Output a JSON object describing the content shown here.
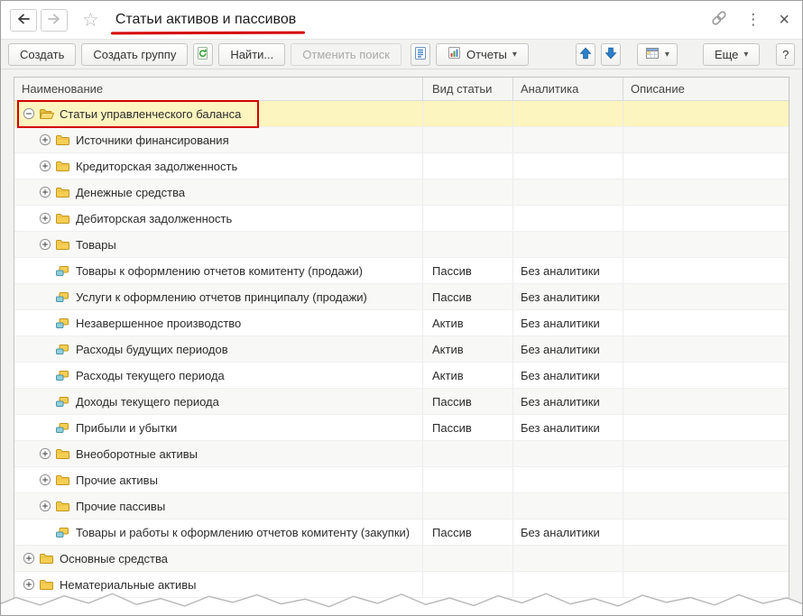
{
  "titlebar": {
    "title": "Статьи активов и пассивов"
  },
  "toolbar": {
    "create_label": "Создать",
    "create_group_label": "Создать группу",
    "find_label": "Найти...",
    "cancel_search_label": "Отменить поиск",
    "reports_label": "Отчеты",
    "more_label": "Еще",
    "help_label": "?"
  },
  "table": {
    "columns": [
      "Наименование",
      "Вид статьи",
      "Аналитика",
      "Описание"
    ],
    "rows": [
      {
        "type": "group",
        "level": 0,
        "expanded": true,
        "selected": true,
        "annotated": true,
        "name": "Статьи управленческого баланса",
        "kind": "",
        "analytics": ""
      },
      {
        "type": "group",
        "level": 1,
        "expanded": false,
        "name": "Источники финансирования",
        "kind": "",
        "analytics": ""
      },
      {
        "type": "group",
        "level": 1,
        "expanded": false,
        "name": "Кредиторская задолженность",
        "kind": "",
        "analytics": ""
      },
      {
        "type": "group",
        "level": 1,
        "expanded": false,
        "name": "Денежные средства",
        "kind": "",
        "analytics": ""
      },
      {
        "type": "group",
        "level": 1,
        "expanded": false,
        "name": "Дебиторская задолженность",
        "kind": "",
        "analytics": ""
      },
      {
        "type": "group",
        "level": 1,
        "expanded": false,
        "name": "Товары",
        "kind": "",
        "analytics": ""
      },
      {
        "type": "item",
        "level": 1,
        "name": "Товары к оформлению отчетов комитенту (продажи)",
        "kind": "Пассив",
        "analytics": "Без аналитики"
      },
      {
        "type": "item",
        "level": 1,
        "name": "Услуги к оформлению отчетов принципалу (продажи)",
        "kind": "Пассив",
        "analytics": "Без аналитики"
      },
      {
        "type": "item",
        "level": 1,
        "name": "Незавершенное производство",
        "kind": "Актив",
        "analytics": "Без аналитики"
      },
      {
        "type": "item",
        "level": 1,
        "name": "Расходы будущих периодов",
        "kind": "Актив",
        "analytics": "Без аналитики"
      },
      {
        "type": "item",
        "level": 1,
        "name": "Расходы текущего периода",
        "kind": "Актив",
        "analytics": "Без аналитики"
      },
      {
        "type": "item",
        "level": 1,
        "name": "Доходы текущего периода",
        "kind": "Пассив",
        "analytics": "Без аналитики"
      },
      {
        "type": "item",
        "level": 1,
        "name": "Прибыли и убытки",
        "kind": "Пассив",
        "analytics": "Без аналитики"
      },
      {
        "type": "group",
        "level": 1,
        "expanded": false,
        "name": "Внеоборотные активы",
        "kind": "",
        "analytics": ""
      },
      {
        "type": "group",
        "level": 1,
        "expanded": false,
        "name": "Прочие активы",
        "kind": "",
        "analytics": ""
      },
      {
        "type": "group",
        "level": 1,
        "expanded": false,
        "name": "Прочие пассивы",
        "kind": "",
        "analytics": ""
      },
      {
        "type": "item",
        "level": 1,
        "name": "Товары и работы к оформлению отчетов комитенту (закупки)",
        "kind": "Пассив",
        "analytics": "Без аналитики"
      },
      {
        "type": "group",
        "level": 0,
        "expanded": false,
        "name": "Основные средства",
        "kind": "",
        "analytics": ""
      },
      {
        "type": "group",
        "level": 0,
        "expanded": false,
        "name": "Нематериальные активы",
        "kind": "",
        "analytics": ""
      }
    ]
  },
  "colors": {
    "selection_bg": "#FDF5BF",
    "annotation_red": "#D40000",
    "accent_blue": "#2A7FC9",
    "folder_yellow": "#F6CE53"
  }
}
